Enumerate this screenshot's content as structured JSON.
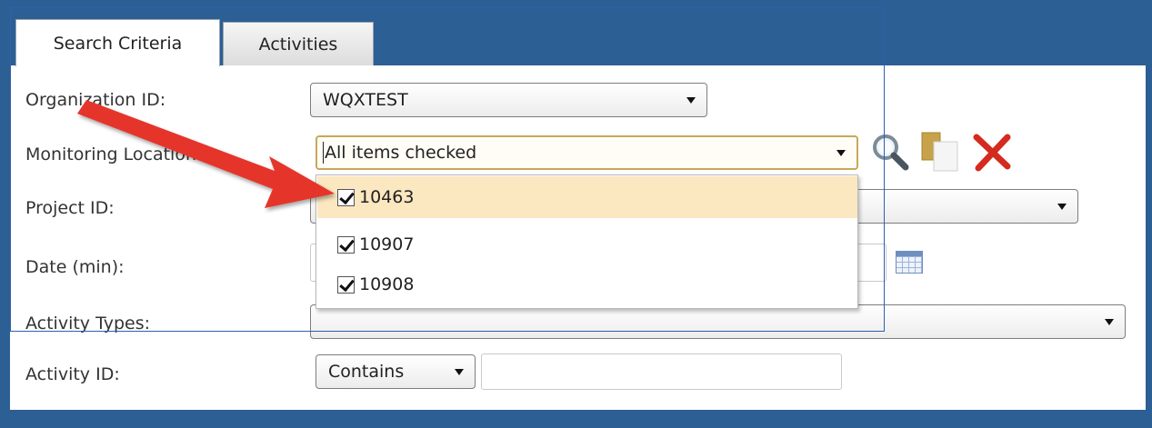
{
  "tabs": [
    {
      "label": "Search Criteria",
      "active": true
    },
    {
      "label": "Activities",
      "active": false
    }
  ],
  "form": {
    "organization_id": {
      "label": "Organization ID:",
      "value": "WQXTEST"
    },
    "monitoring_location": {
      "label": "Monitoring Location:",
      "value": "All items checked"
    },
    "project_id": {
      "label": "Project ID:",
      "value": ""
    },
    "date_min": {
      "label": "Date (min):",
      "value": ""
    },
    "activity_types": {
      "label": "Activity Types:",
      "value": ""
    },
    "activity_id": {
      "label": "Activity ID:",
      "operator": "Contains",
      "value": ""
    }
  },
  "dropdown": {
    "items": [
      {
        "label": "10463",
        "checked": true,
        "highlighted": true
      },
      {
        "label": "10907",
        "checked": true,
        "highlighted": false
      },
      {
        "label": "10908",
        "checked": true,
        "highlighted": false
      }
    ]
  },
  "toolbar_icons": [
    "search-icon",
    "copy-icon",
    "clear-icon",
    "calendar-icon"
  ],
  "colors": {
    "frame_blue": "#2c5f94",
    "highlight": "#fbe7c0",
    "focus_border": "#c7a85a",
    "arrow_red": "#e5352b",
    "delete_red": "#d42a1f"
  }
}
